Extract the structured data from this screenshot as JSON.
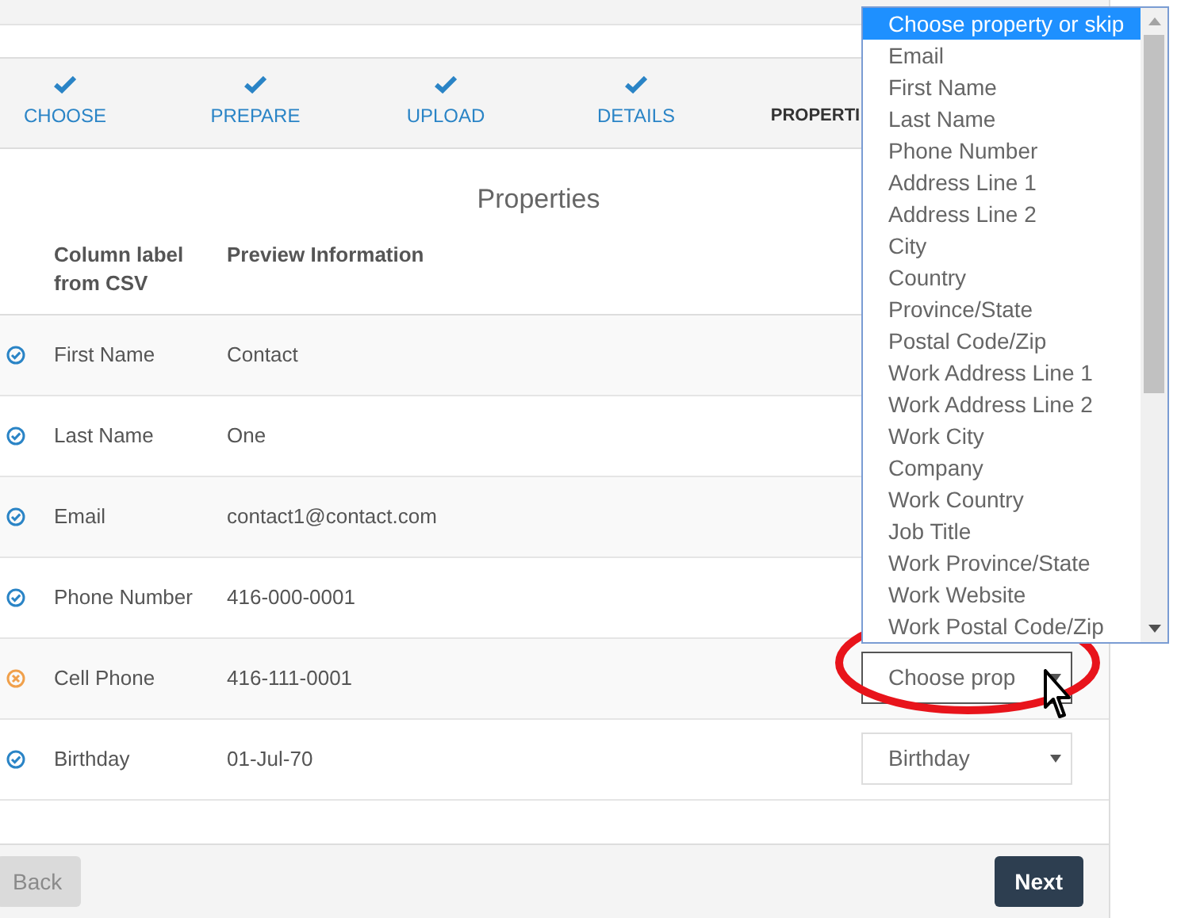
{
  "steps": [
    {
      "label": "CHOOSE",
      "done": true
    },
    {
      "label": "PREPARE",
      "done": true
    },
    {
      "label": "UPLOAD",
      "done": true
    },
    {
      "label": "DETAILS",
      "done": true
    },
    {
      "label": "PROPERTI",
      "done": false
    }
  ],
  "heading": "Properties",
  "table": {
    "columns": [
      "Column label from CSV",
      "Preview Information"
    ],
    "rows": [
      {
        "label": "First Name",
        "preview": "Contact",
        "mapped": true
      },
      {
        "label": "Last Name",
        "preview": "One",
        "mapped": true
      },
      {
        "label": "Email",
        "preview": "contact1@contact.com",
        "mapped": true
      },
      {
        "label": "Phone Number",
        "preview": "416-000-0001",
        "mapped": true
      },
      {
        "label": "Cell Phone",
        "preview": "416-111-0001",
        "mapped": false,
        "select": "Choose prop",
        "highlighted": true
      },
      {
        "label": "Birthday",
        "preview": "01-Jul-70",
        "mapped": true,
        "select": "Birthday",
        "highlighted": false
      }
    ]
  },
  "dropdown": {
    "options": [
      {
        "label": "Choose property or skip",
        "selected": true
      },
      {
        "label": "Email",
        "selected": false
      },
      {
        "label": "First Name",
        "selected": false
      },
      {
        "label": "Last Name",
        "selected": false
      },
      {
        "label": "Phone Number",
        "selected": false
      },
      {
        "label": "Address Line 1",
        "selected": false
      },
      {
        "label": "Address Line 2",
        "selected": false
      },
      {
        "label": "City",
        "selected": false
      },
      {
        "label": "Country",
        "selected": false
      },
      {
        "label": "Province/State",
        "selected": false
      },
      {
        "label": "Postal Code/Zip",
        "selected": false
      },
      {
        "label": "Work Address Line 1",
        "selected": false
      },
      {
        "label": "Work Address Line 2",
        "selected": false
      },
      {
        "label": "Work City",
        "selected": false
      },
      {
        "label": "Company",
        "selected": false
      },
      {
        "label": "Work Country",
        "selected": false
      },
      {
        "label": "Job Title",
        "selected": false
      },
      {
        "label": "Work Province/State",
        "selected": false
      },
      {
        "label": "Work Website",
        "selected": false
      },
      {
        "label": "Work Postal Code/Zip",
        "selected": false
      }
    ]
  },
  "buttons": [
    {
      "label": "Back",
      "disabled": true
    },
    {
      "label": "Next",
      "disabled": false
    }
  ]
}
